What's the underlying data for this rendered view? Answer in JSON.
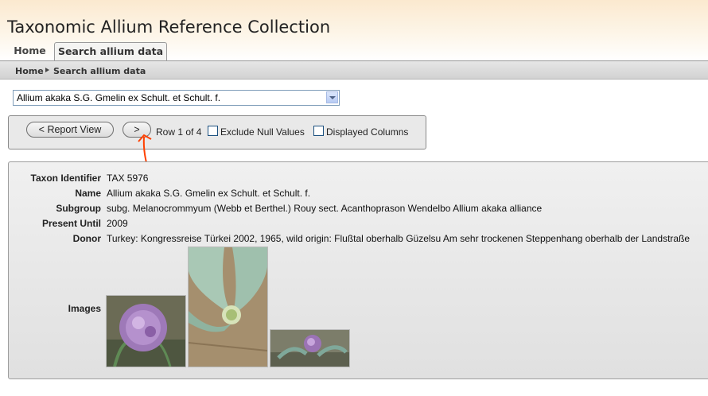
{
  "header": {
    "title": "Taxonomic Allium Reference Collection"
  },
  "tabs": [
    {
      "label": "Home"
    },
    {
      "label": "Search allium data"
    }
  ],
  "breadcrumb": {
    "home": "Home",
    "current": "Search allium data"
  },
  "record_select": {
    "value": "Allium akaka S.G. Gmelin ex Schult. et Schult. f."
  },
  "toolbar": {
    "report_view_label": "< Report View",
    "next_label": ">",
    "row_info": "Row 1 of 4",
    "exclude_null_label": "Exclude Null Values",
    "exclude_null_checked": false,
    "displayed_columns_label": "Displayed Columns",
    "displayed_columns_checked": false
  },
  "details": {
    "fields": [
      {
        "label": "Taxon Identifier",
        "value": "TAX 5976"
      },
      {
        "label": "Name",
        "value": "Allium akaka S.G. Gmelin ex Schult. et Schult. f."
      },
      {
        "label": "Subgroup",
        "value": "subg. Melanocrommyum (Webb et Berthel.) Rouy sect. Acanthoprason Wendelbo Allium akaka alliance"
      },
      {
        "label": "Present Until",
        "value": "2009"
      },
      {
        "label": "Donor",
        "value": "Turkey: Kongressreise Türkei 2002, 1965, wild origin: Flußtal oberhalb Güzelsu Am sehr trockenen Steppenhang oberhalb der Landstraße"
      }
    ],
    "images_label": "Images",
    "images": [
      {
        "subject": "purple allium flower head"
      },
      {
        "subject": "allium leaves with emerging bud"
      },
      {
        "subject": "allium plant in habitat"
      }
    ]
  },
  "annotation": {
    "color": "#ff4000"
  }
}
